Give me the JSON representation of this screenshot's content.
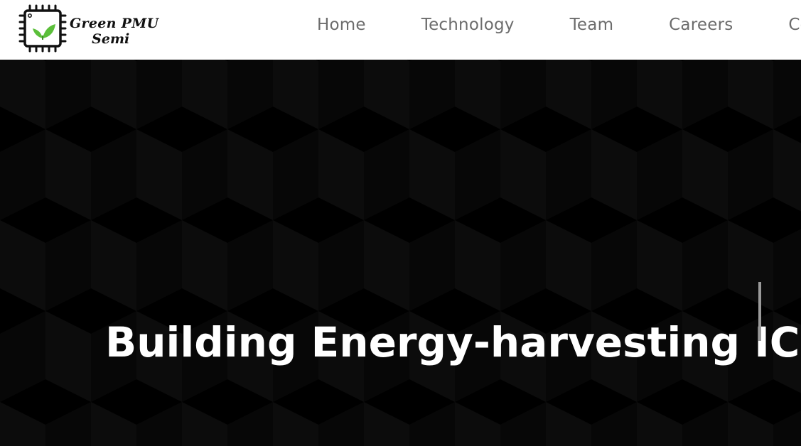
{
  "brand": {
    "line1": "Green PMU",
    "line2": "Semi",
    "colors": {
      "leaf_green": "#5bbf3a",
      "chip_outline": "#111111"
    }
  },
  "nav": {
    "items": [
      {
        "label": "Home"
      },
      {
        "label": "Technology"
      },
      {
        "label": "Team"
      },
      {
        "label": "Careers"
      },
      {
        "label": "Cor"
      }
    ]
  },
  "hero": {
    "title": "Building Energy-harvesting IC",
    "background": "#000000",
    "pattern_color": "#0d0d0d"
  }
}
